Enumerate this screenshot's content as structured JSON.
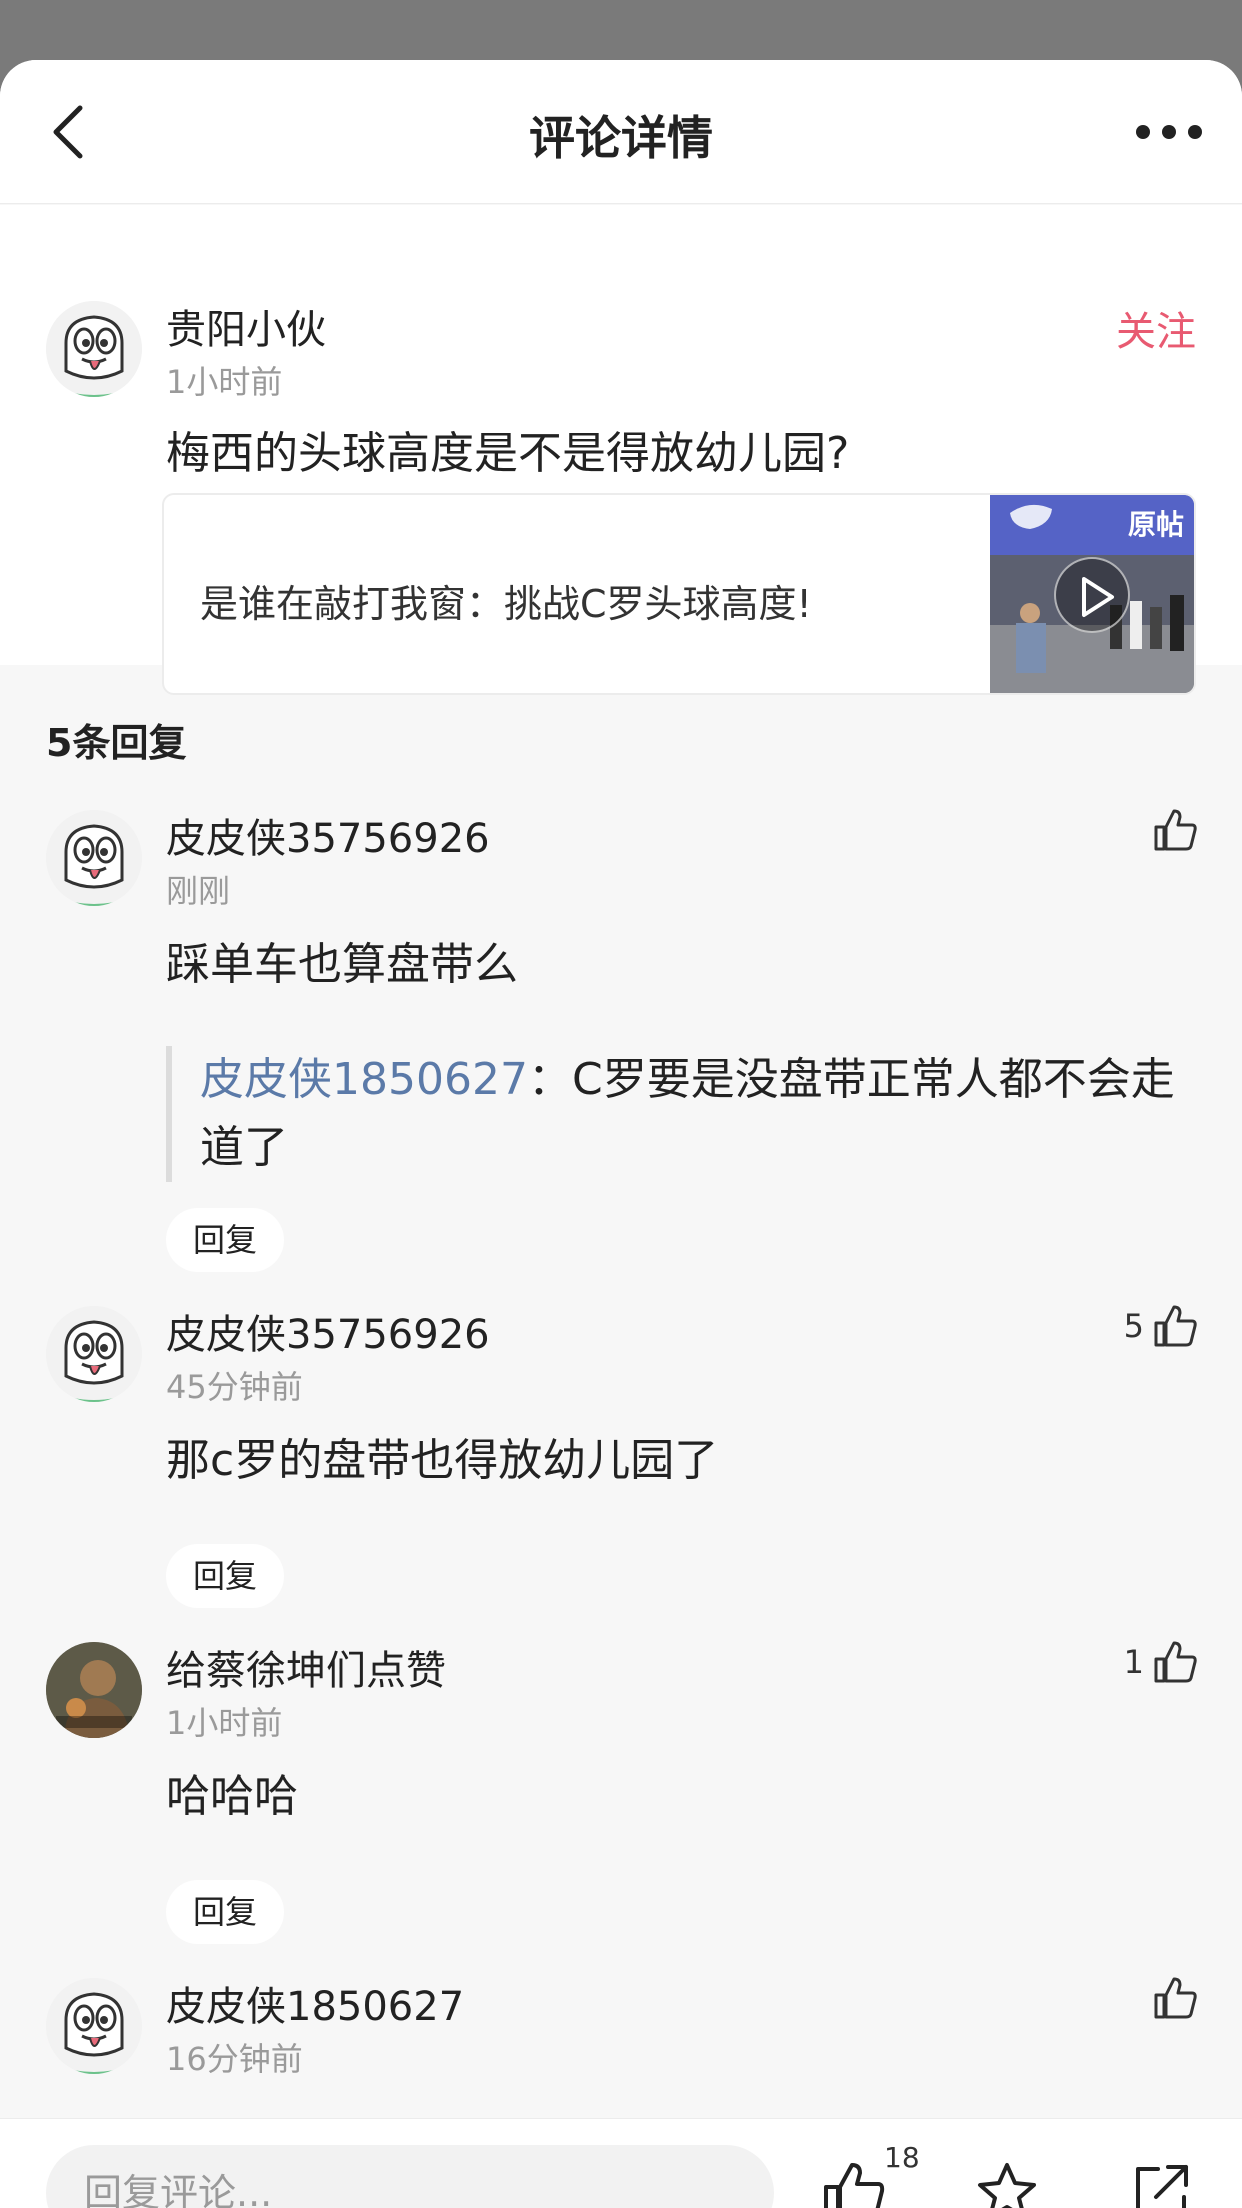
{
  "header": {
    "title": "评论详情",
    "back_icon": "chevron-left-icon",
    "more_icon": "more-dots-icon"
  },
  "main_comment": {
    "username": "贵阳小伙",
    "time": "1小时前",
    "follow_label": "关注",
    "text": "梅西的头球高度是不是得放幼儿园?",
    "post": {
      "title": "是谁在敲打我窗：挑战C罗头球高度!",
      "thumb_badge": "原帖"
    }
  },
  "replies_header": "5条回复",
  "replies": [
    {
      "username": "皮皮侠35756926",
      "time": "刚刚",
      "text": "踩单车也算盘带么",
      "likes": "",
      "quote": {
        "mention": "皮皮侠1850627",
        "separator": "：",
        "text": "C罗要是没盘带正常人都不会走道了"
      },
      "reply_label": "回复"
    },
    {
      "username": "皮皮侠35756926",
      "time": "45分钟前",
      "text": "那c罗的盘带也得放幼儿园了",
      "likes": "5",
      "reply_label": "回复"
    },
    {
      "username": "给蔡徐坤们点赞",
      "time": "1小时前",
      "text": "哈哈哈",
      "likes": "1",
      "reply_label": "回复"
    },
    {
      "username": "皮皮侠1850627",
      "time": "16分钟前",
      "likes": ""
    }
  ],
  "bottom_bar": {
    "input_placeholder": "回复评论...",
    "like_count": "18",
    "icons": [
      "thumbs-up-icon",
      "star-icon",
      "share-icon"
    ]
  },
  "colors": {
    "follow": "#e85a71",
    "mention": "#5b7aa8",
    "background": "#f7f7f7"
  }
}
